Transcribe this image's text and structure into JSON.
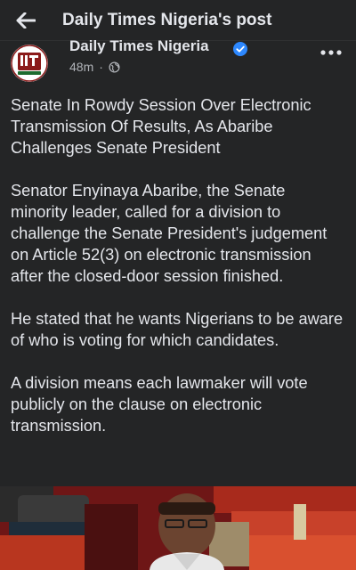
{
  "topbar": {
    "title": "Daily Times Nigeria's post",
    "back_icon": "arrow-left-icon"
  },
  "post": {
    "page_name": "Daily Times Nigeria",
    "time": "48m",
    "separator": "·",
    "audience_icon": "globe-icon",
    "verified_icon": "verified-badge-icon",
    "more_icon": "more-options-icon",
    "paragraphs": [
      "Senate In Rowdy Session Over Electronic Transmission Of Results, As Abaribe Challenges Senate President",
      "Senator Enyinaya Abaribe, the Senate minority leader, called for a division to challenge the Senate President's judgement on Article 52(3) on electronic transmission after the closed-door session finished.",
      "He stated that he wants Nigerians to be aware of who is voting for which candidates.",
      "A division means each lawmaker will vote publicly on the clause on electronic transmission."
    ]
  },
  "colors": {
    "background": "#18191a",
    "surface": "#242526",
    "text": "#e4e6eb",
    "secondary_text": "#b0b3b8",
    "verified": "#2d88ff",
    "logo_red": "#8b1a1a",
    "logo_green": "#1d6b2f"
  }
}
